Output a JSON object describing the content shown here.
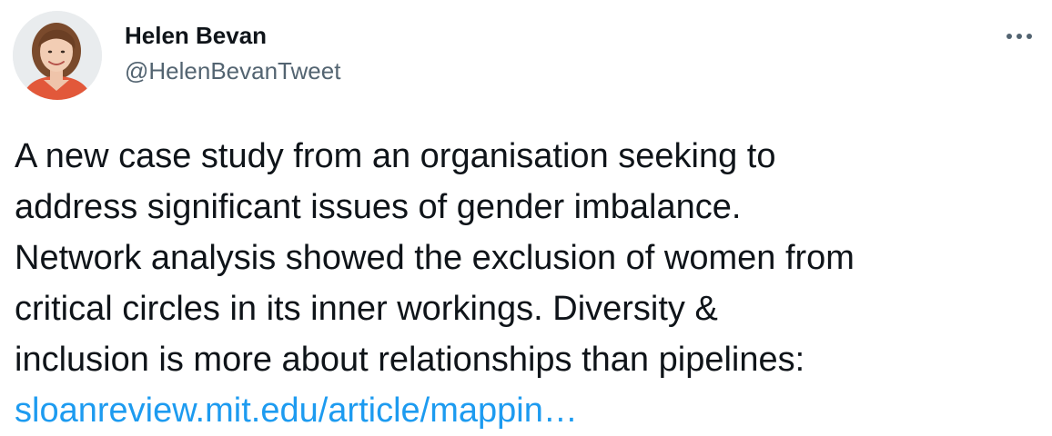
{
  "author": {
    "display_name": "Helen Bevan",
    "handle": "@HelenBevanTweet",
    "avatar_icon": "profile-photo"
  },
  "more_icon": "more-options-icon",
  "tweet": {
    "lines": [
      "A new case study from an organisation seeking to",
      "address significant issues of gender imbalance.",
      "Network analysis showed the exclusion of women from",
      "critical circles in its inner workings. Diversity &",
      "inclusion is more about relationships than pipelines:"
    ],
    "link_text": "sloanreview.mit.edu/article/mappin…"
  },
  "colors": {
    "text": "#0f1419",
    "secondary": "#536471",
    "link": "#1d9bf0"
  }
}
